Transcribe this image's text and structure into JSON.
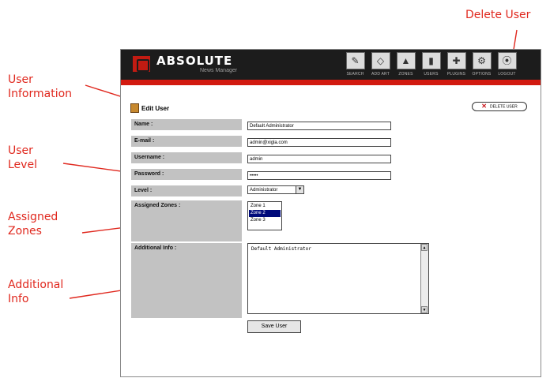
{
  "callouts": {
    "user_information": "User\nInformation",
    "user_level": "User\nLevel",
    "assigned_zones": "Assigned\nZones",
    "additional_info": "Additional\nInfo",
    "delete_user": "Delete User"
  },
  "header": {
    "logo_title": "ABSOLUTE",
    "logo_subtitle": "News Manager",
    "nav": [
      {
        "icon": "search-icon",
        "glyph": "✎",
        "label": "SEARCH"
      },
      {
        "icon": "add-article-icon",
        "glyph": "◇",
        "label": "ADD ART"
      },
      {
        "icon": "zones-icon",
        "glyph": "▲",
        "label": "ZONES"
      },
      {
        "icon": "users-icon",
        "glyph": "▮",
        "label": "USERS"
      },
      {
        "icon": "plugins-icon",
        "glyph": "✚",
        "label": "PLUGINS"
      },
      {
        "icon": "options-icon",
        "glyph": "⚙",
        "label": "OPTIONS"
      },
      {
        "icon": "logout-icon",
        "glyph": "⦿",
        "label": "LOGOUT"
      }
    ]
  },
  "page": {
    "title": "Edit User",
    "delete_label": "DELETE USER"
  },
  "form": {
    "name_label": "Name :",
    "name_value": "Default Administrator",
    "email_label": "E-mail :",
    "email_value": "admin@xigla.com",
    "username_label": "Username :",
    "username_value": "admin",
    "password_label": "Password :",
    "password_value": "•••••",
    "level_label": "Level :",
    "level_value": "Administrator",
    "zones_label": "Assigned Zones :",
    "zones": [
      "Zone 1",
      "Zone 2",
      "Zone 3"
    ],
    "zones_selected": "Zone 2",
    "info_label": "Additional Info :",
    "info_value": "Default Administrator",
    "save_label": "Save User"
  },
  "colors": {
    "callout": "#e0281e",
    "header_bg": "#1c1c1c",
    "header_stripe": "#d21a10",
    "label_bg": "#c2c2c2",
    "selection": "#000a7a"
  }
}
